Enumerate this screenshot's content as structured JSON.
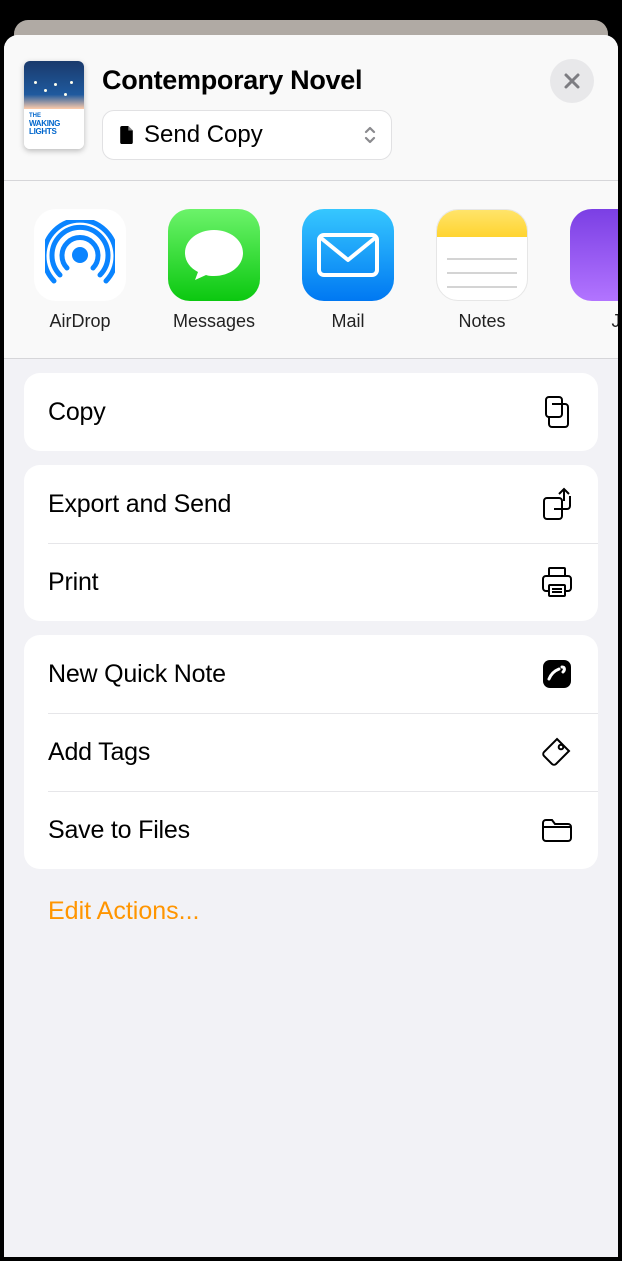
{
  "header": {
    "title": "Contemporary Novel",
    "thumbnail": {
      "line1": "THE",
      "line2": "WAKING",
      "line3": "LIGHTS"
    },
    "picker": {
      "label": "Send Copy"
    }
  },
  "share_targets": [
    {
      "label": "AirDrop",
      "icon": "airdrop"
    },
    {
      "label": "Messages",
      "icon": "messages"
    },
    {
      "label": "Mail",
      "icon": "mail"
    },
    {
      "label": "Notes",
      "icon": "notes"
    },
    {
      "label": "J",
      "icon": "journal"
    }
  ],
  "action_groups": [
    [
      {
        "label": "Copy",
        "icon": "copy-icon"
      }
    ],
    [
      {
        "label": "Export and Send",
        "icon": "export-send-icon"
      },
      {
        "label": "Print",
        "icon": "print-icon"
      }
    ],
    [
      {
        "label": "New Quick Note",
        "icon": "quicknote-icon"
      },
      {
        "label": "Add Tags",
        "icon": "tag-icon"
      },
      {
        "label": "Save to Files",
        "icon": "folder-icon"
      }
    ]
  ],
  "edit_actions_label": "Edit Actions..."
}
